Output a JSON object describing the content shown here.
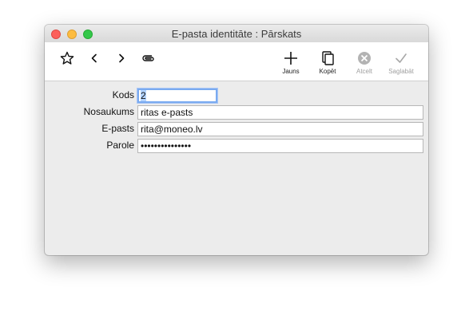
{
  "window": {
    "title": "E-pasta identitāte : Pārskats"
  },
  "toolbar": {
    "left_icons": [
      "star-icon",
      "chevron-left-icon",
      "chevron-right-icon",
      "paperclip-icon"
    ],
    "new_label": "Jauns",
    "copy_label": "Kopēt",
    "cancel_label": "Atcelt",
    "save_label": "Saglabāt"
  },
  "form": {
    "kods_label": "Kods",
    "kods_value": "2",
    "nosaukums_label": "Nosaukums",
    "nosaukums_value": "ritas e-pasts",
    "epasts_label": "E-pasts",
    "epasts_value": "rita@moneo.lv",
    "parole_label": "Parole",
    "parole_value": "•••••••••••••••"
  },
  "colors": {
    "close": "#fc605b",
    "minimize": "#fdbc40",
    "zoom": "#34c84a",
    "focus_ring": "#7aaaf0"
  }
}
